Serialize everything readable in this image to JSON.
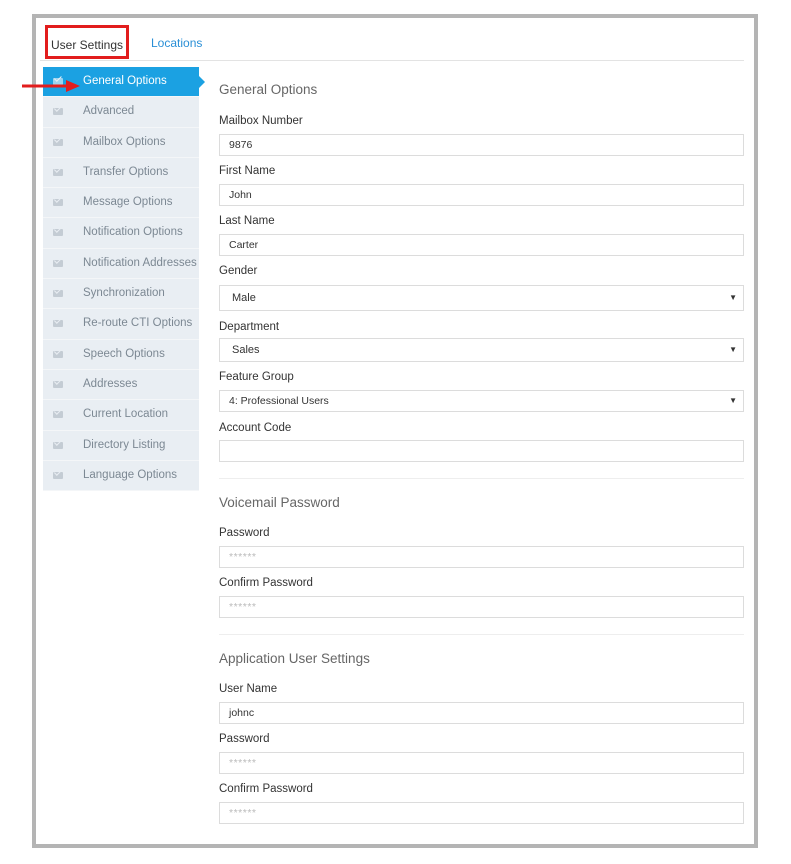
{
  "tabs": {
    "user_settings": "User Settings",
    "locations": "Locations"
  },
  "sidebar": {
    "items": [
      {
        "label": "General Options"
      },
      {
        "label": "Advanced"
      },
      {
        "label": "Mailbox Options"
      },
      {
        "label": "Transfer Options"
      },
      {
        "label": "Message Options"
      },
      {
        "label": "Notification Options"
      },
      {
        "label": "Notification Addresses"
      },
      {
        "label": "Synchronization"
      },
      {
        "label": "Re-route CTI Options"
      },
      {
        "label": "Speech Options"
      },
      {
        "label": "Addresses"
      },
      {
        "label": "Current Location"
      },
      {
        "label": "Directory Listing"
      },
      {
        "label": "Language Options"
      }
    ]
  },
  "general": {
    "title": "General Options",
    "mailbox_label": "Mailbox Number",
    "mailbox_value": "9876",
    "first_label": "First Name",
    "first_value": "John",
    "last_label": "Last Name",
    "last_value": "Carter",
    "gender_label": "Gender",
    "gender_value": "Male",
    "department_label": "Department",
    "department_value": "Sales",
    "feature_label": "Feature Group",
    "feature_value": "4: Professional Users",
    "account_label": "Account Code",
    "account_value": ""
  },
  "voicemail": {
    "title": "Voicemail Password",
    "password_label": "Password",
    "password_value": "******",
    "confirm_label": "Confirm Password",
    "confirm_value": "******"
  },
  "app_user": {
    "title": "Application User Settings",
    "username_label": "User Name",
    "username_value": "johnc",
    "password_label": "Password",
    "password_value": "******",
    "confirm_label": "Confirm Password",
    "confirm_value": "******"
  },
  "colors": {
    "accent": "#1ba1e2",
    "highlight": "#e21d1d",
    "link": "#2a8fd6"
  },
  "icons": {
    "sidebar_item": "envelope-icon",
    "select": "caret-down-icon",
    "annotation": "arrow-right-icon"
  }
}
